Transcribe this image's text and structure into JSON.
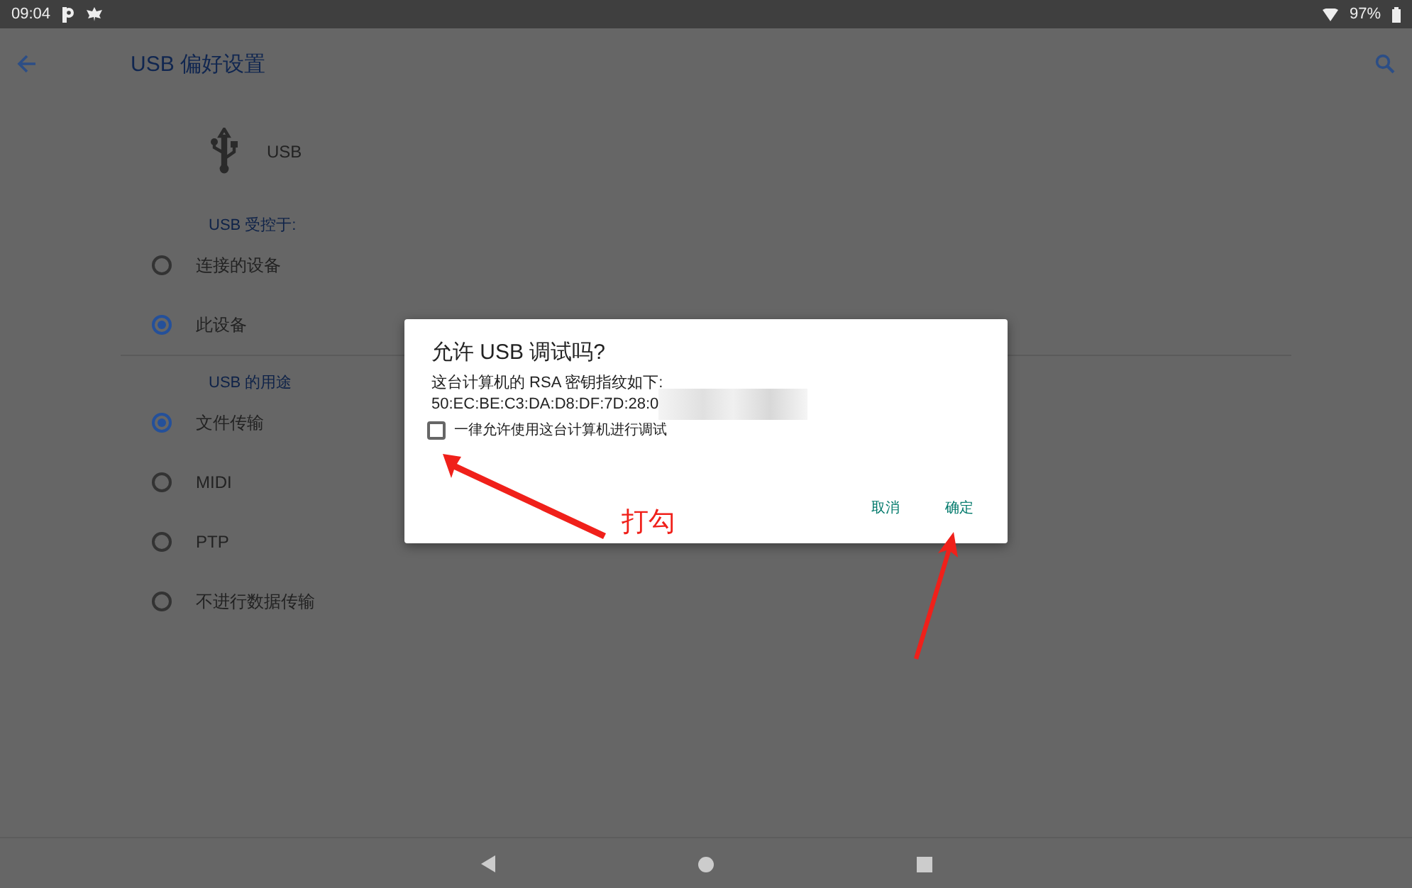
{
  "status_bar": {
    "time": "09:04",
    "battery": "97%"
  },
  "toolbar": {
    "title": "USB 偏好设置"
  },
  "device": {
    "label": "USB"
  },
  "sections": [
    {
      "heading": "USB 受控于:",
      "options": [
        {
          "label": "连接的设备",
          "selected": false
        },
        {
          "label": "此设备",
          "selected": true
        }
      ]
    },
    {
      "heading": "USB 的用途",
      "options": [
        {
          "label": "文件传输",
          "selected": true
        },
        {
          "label": "MIDI",
          "selected": false
        },
        {
          "label": "PTP",
          "selected": false
        },
        {
          "label": "不进行数据传输",
          "selected": false
        }
      ]
    }
  ],
  "dialog": {
    "title": "允许 USB 调试吗?",
    "message": "这台计算机的 RSA 密钥指纹如下:",
    "fingerprint": "50:EC:BE:C3:DA:D8:DF:7D:28:0",
    "checkbox": {
      "label": "一律允许使用这台计算机进行调试",
      "checked": false
    },
    "buttons": [
      "取消",
      "确定"
    ]
  },
  "annotation": {
    "label": "打勾"
  }
}
